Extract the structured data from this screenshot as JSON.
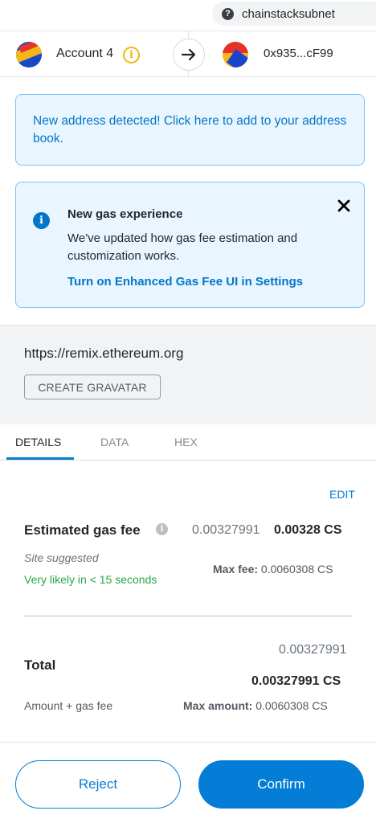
{
  "network": {
    "name": "chainstacksubnet",
    "help_icon_glyph": "?"
  },
  "accounts": {
    "from_name": "Account 4",
    "info_icon_glyph": "i",
    "to_address": "0x935...cF99"
  },
  "address_alert": {
    "text": "New address detected! Click here to add to your address book."
  },
  "gas_notice": {
    "info_glyph": "i",
    "title": "New gas experience",
    "body": "We've updated how gas fee estimation and customization works.",
    "link": "Turn on Enhanced Gas Fee UI in Settings"
  },
  "origin": {
    "url": "https://remix.ethereum.org",
    "gravatar_button": "CREATE GRAVATAR"
  },
  "tabs": [
    {
      "label": "DETAILS",
      "active": true
    },
    {
      "label": "DATA",
      "active": false
    },
    {
      "label": "HEX",
      "active": false
    }
  ],
  "details": {
    "edit_label": "EDIT",
    "gas_fee_label": "Estimated gas fee",
    "gas_fee_info_glyph": "i",
    "gas_fee_value": "0.00327991",
    "gas_fee_value_bold": "0.00328 CS",
    "site_suggested": "Site suggested",
    "likely_text": "Very likely in < 15 seconds",
    "max_fee_label": "Max fee:",
    "max_fee_value": "0.0060308 CS",
    "total_label": "Total",
    "total_value": "0.00327991",
    "total_value_bold": "0.00327991 CS",
    "amount_label": "Amount + gas fee",
    "max_amount_label": "Max amount:",
    "max_amount_value": "0.0060308 CS"
  },
  "footer": {
    "reject_label": "Reject",
    "confirm_label": "Confirm"
  },
  "colors": {
    "primary": "#037dd6",
    "alert_bg": "#eaf6ff",
    "alert_border": "#75c4fd",
    "success": "#28a745",
    "warning": "#f0b90b"
  }
}
